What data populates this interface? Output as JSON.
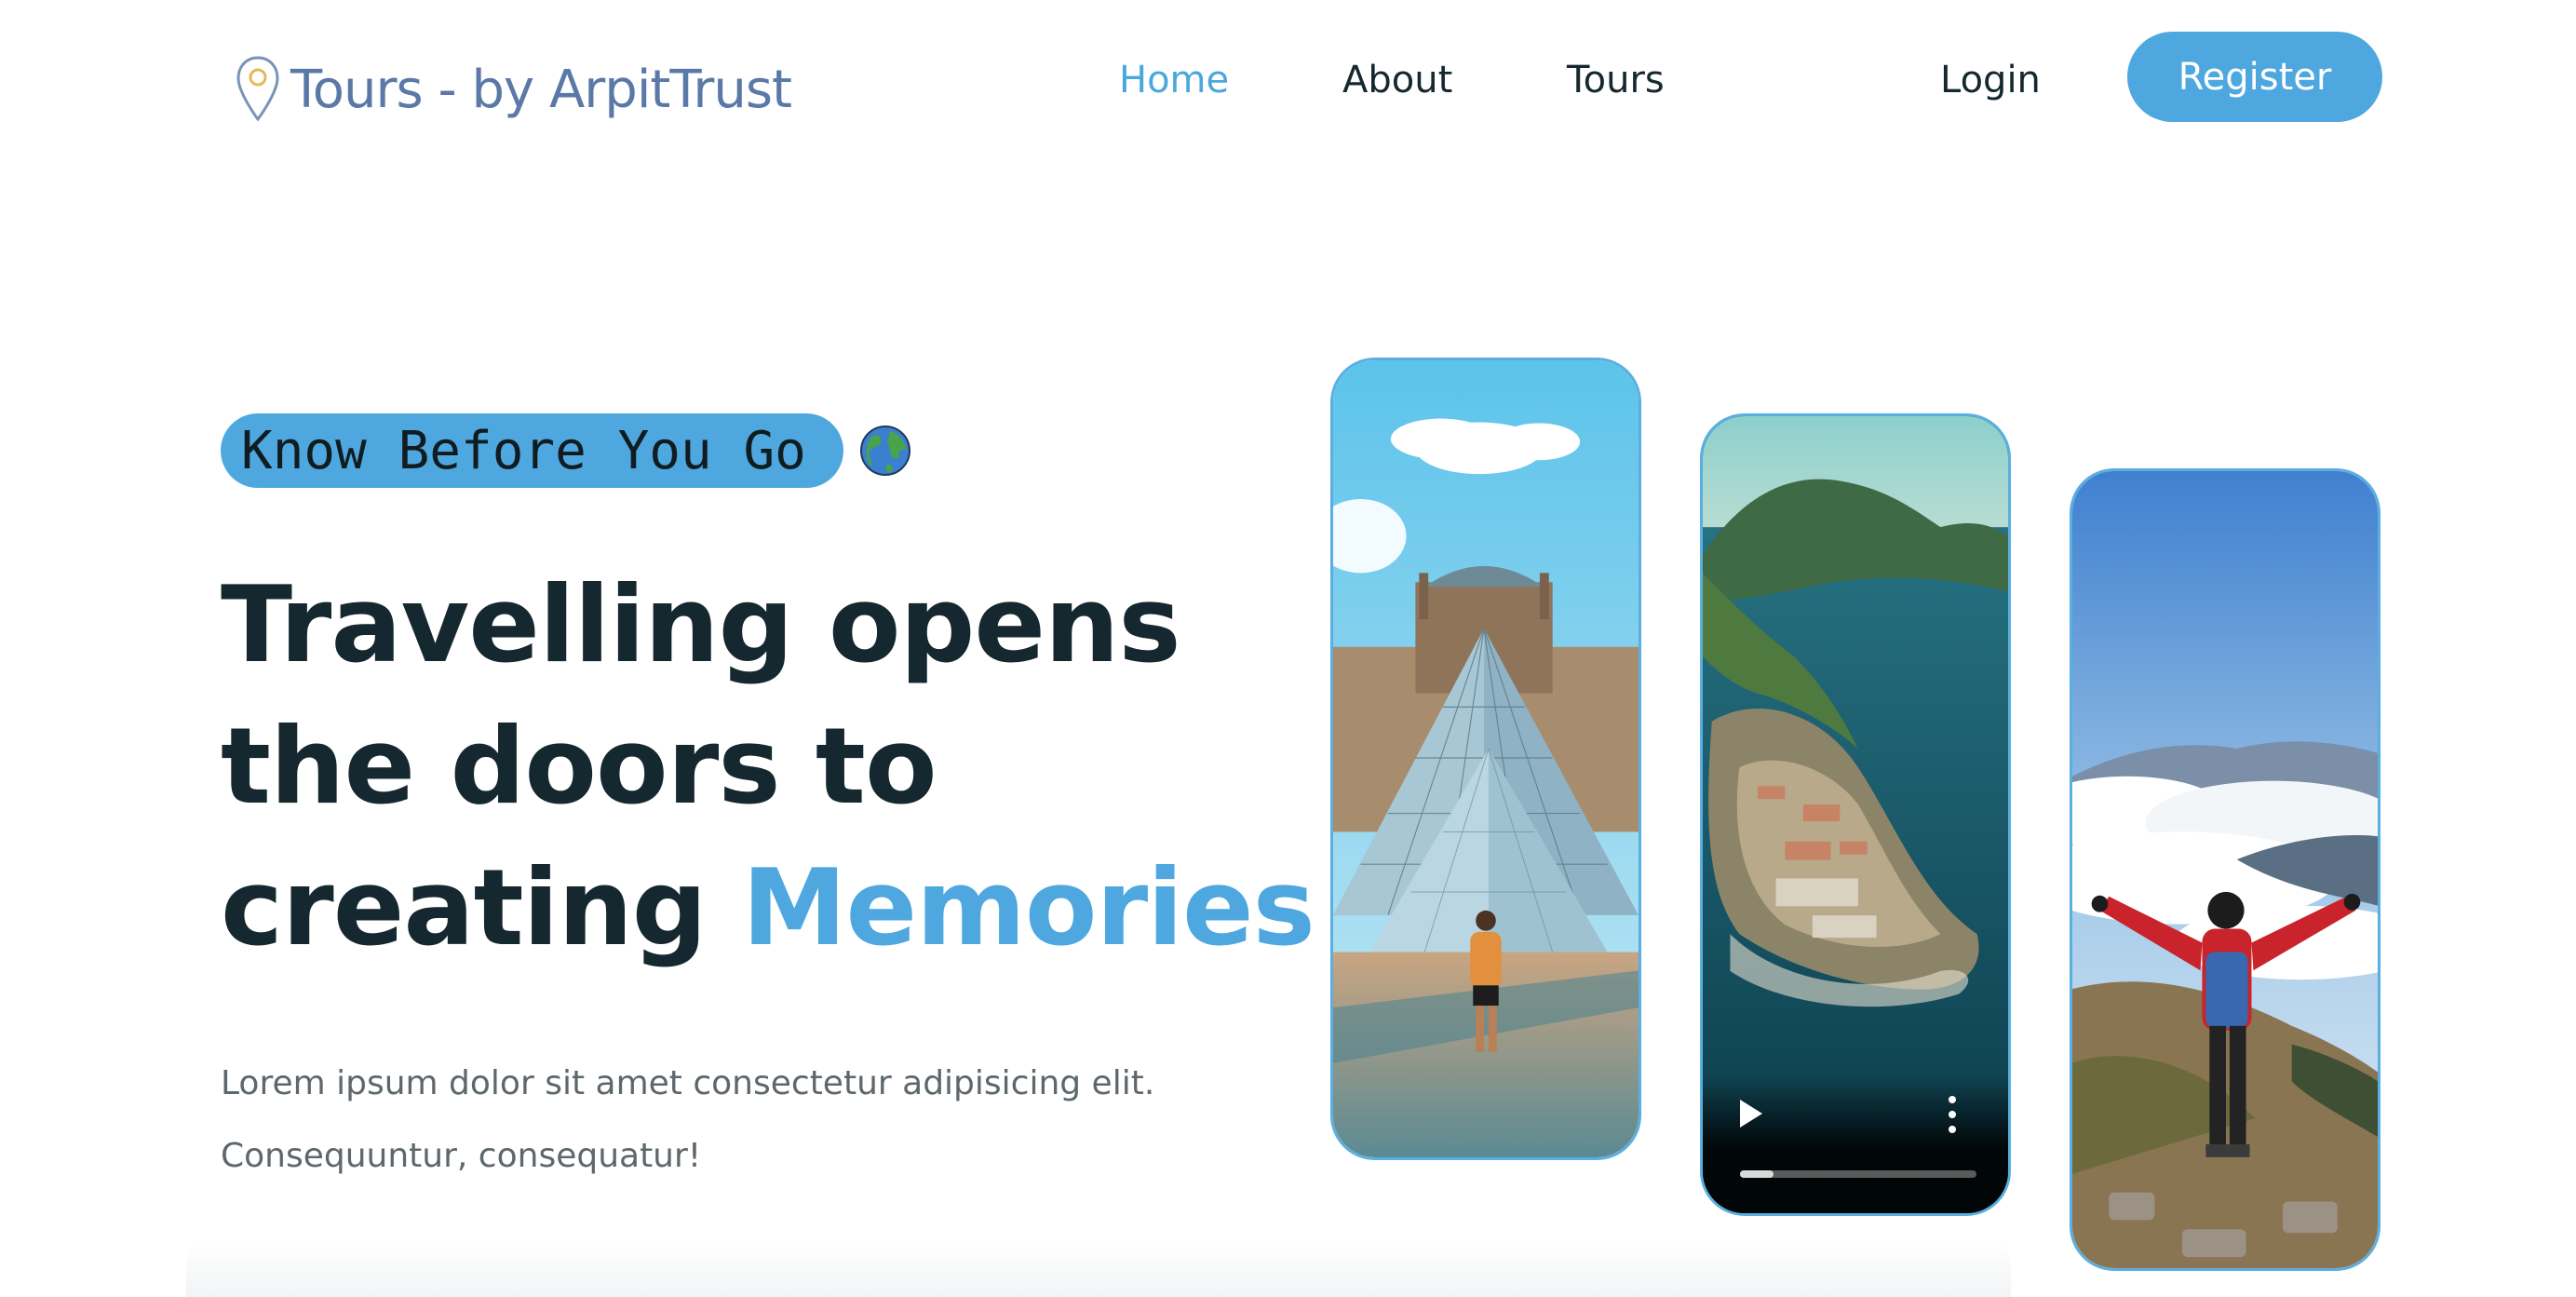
{
  "header": {
    "logo_text": "Tours - by ArpitTrust",
    "nav": [
      {
        "label": "Home",
        "active": true
      },
      {
        "label": "About",
        "active": false
      },
      {
        "label": "Tours",
        "active": false
      }
    ],
    "login_label": "Login",
    "register_label": "Register"
  },
  "hero": {
    "tagline": "Know Before You Go",
    "headline_line1": "Travelling opens",
    "headline_line2": "the doors to",
    "headline_line3_prefix": "creating ",
    "headline_accent": "Memories",
    "lead_line1": "Lorem ipsum dolor sit amet consectetur adipisicing elit.",
    "lead_line2": "Consequuntur, consequatur!"
  },
  "gallery": {
    "cards": [
      {
        "image": "louvre-pyramid-traveler-photo"
      },
      {
        "image": "island-fortress-aerial-video",
        "video_progress": 0.14
      },
      {
        "image": "mountain-hiker-photo"
      }
    ]
  },
  "colors": {
    "accent": "#4ea8df",
    "text_dark": "#16282f",
    "text_muted": "#5d676c",
    "logo": "#5b79a6"
  },
  "icons": [
    "location-pin-icon",
    "globe-icon",
    "play-icon",
    "more-vertical-icon"
  ]
}
